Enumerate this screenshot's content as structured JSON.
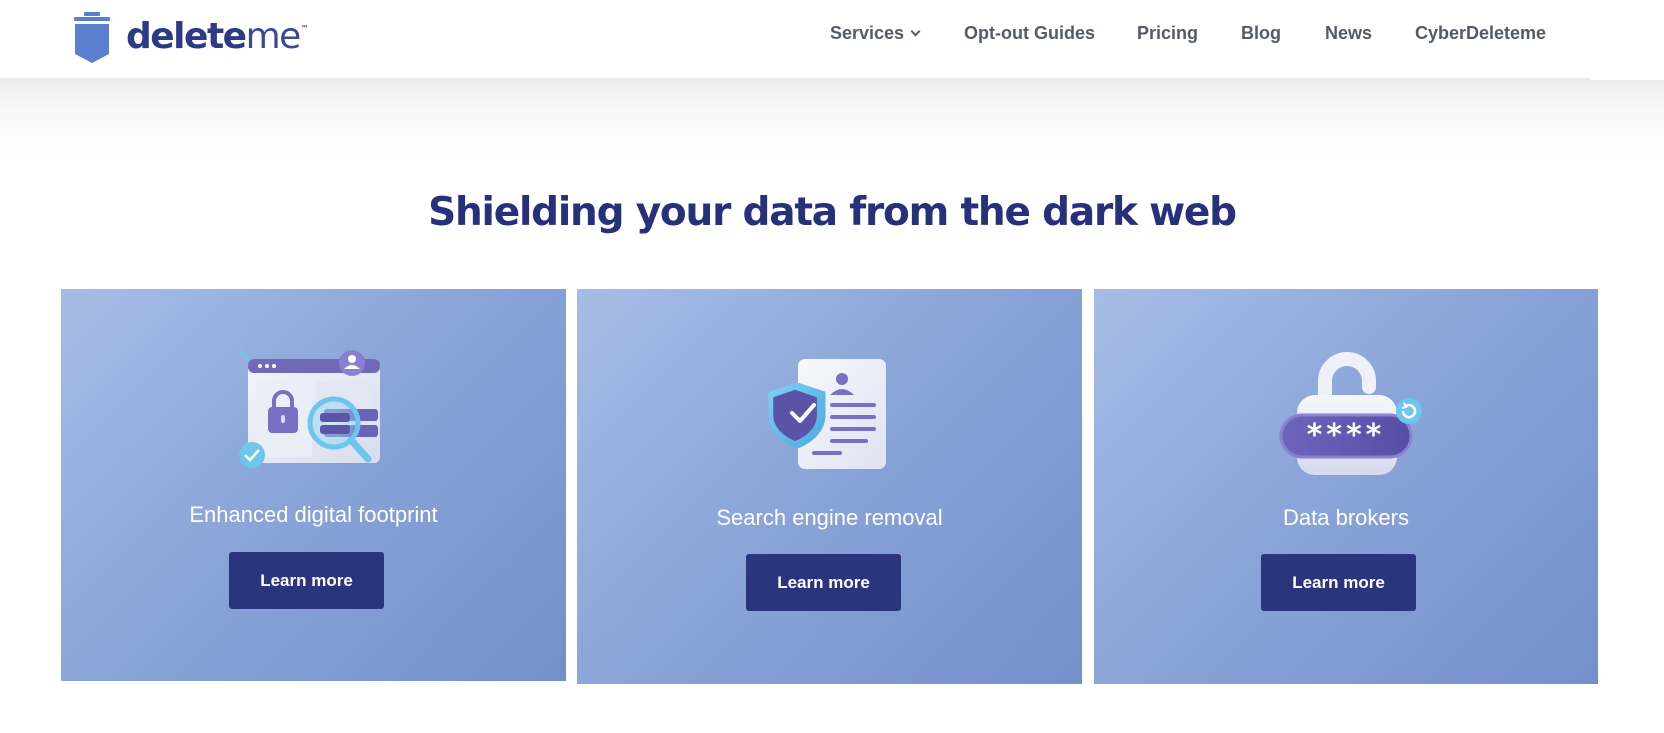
{
  "logo": {
    "brand_bold": "delete",
    "brand_light": "me",
    "trademark": "™"
  },
  "nav": {
    "items": [
      {
        "label": "Services",
        "has_dropdown": true
      },
      {
        "label": "Opt-out Guides"
      },
      {
        "label": "Pricing"
      },
      {
        "label": "Blog"
      },
      {
        "label": "News"
      },
      {
        "label": "CyberDeleteme"
      }
    ]
  },
  "main": {
    "heading": "Shielding your data from the dark web",
    "cards": [
      {
        "title": "Enhanced digital footprint",
        "button": "Learn more",
        "icon": "browser-lock-magnifier-icon"
      },
      {
        "title": "Search engine removal",
        "button": "Learn more",
        "icon": "shield-document-icon"
      },
      {
        "title": "Data brokers",
        "button": "Learn more",
        "icon": "padlock-password-icon"
      }
    ]
  },
  "colors": {
    "brand_navy": "#2a357e",
    "heading": "#27307a",
    "nav_text": "#545b66",
    "card_gradient_start": "#a6bde6",
    "card_gradient_end": "#7490cc"
  }
}
